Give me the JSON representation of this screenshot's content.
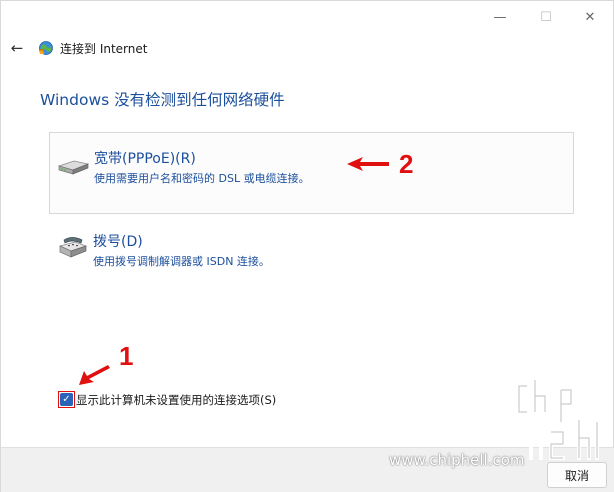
{
  "window": {
    "minimize_glyph": "—",
    "maximize_glyph": "☐",
    "close_glyph": "✕"
  },
  "header": {
    "back_glyph": "←",
    "title": "连接到 Internet"
  },
  "main": {
    "heading": "Windows 没有检测到任何网络硬件",
    "options": [
      {
        "title": "宽带(PPPoE)(R)",
        "description": "使用需要用户名和密码的 DSL 或电缆连接。",
        "icon": "broadband-modem-icon",
        "selected": true
      },
      {
        "title": "拨号(D)",
        "description": "使用拨号调制解调器或 ISDN 连接。",
        "icon": "dialup-phone-icon",
        "selected": false
      }
    ],
    "checkbox": {
      "label": "显示此计算机未设置使用的连接选项(S)",
      "checked": true,
      "check_glyph": "✓"
    }
  },
  "annotations": {
    "label_1": "1",
    "label_2": "2",
    "color": "#e01010"
  },
  "footer": {
    "cancel_label": "取消"
  },
  "watermark": {
    "url": "www.chiphell.com",
    "logo": "chiphell"
  },
  "colors": {
    "accent": "#1c4f9c",
    "checkbox": "#2a63b8",
    "footer_bg": "#f0f0f0"
  }
}
